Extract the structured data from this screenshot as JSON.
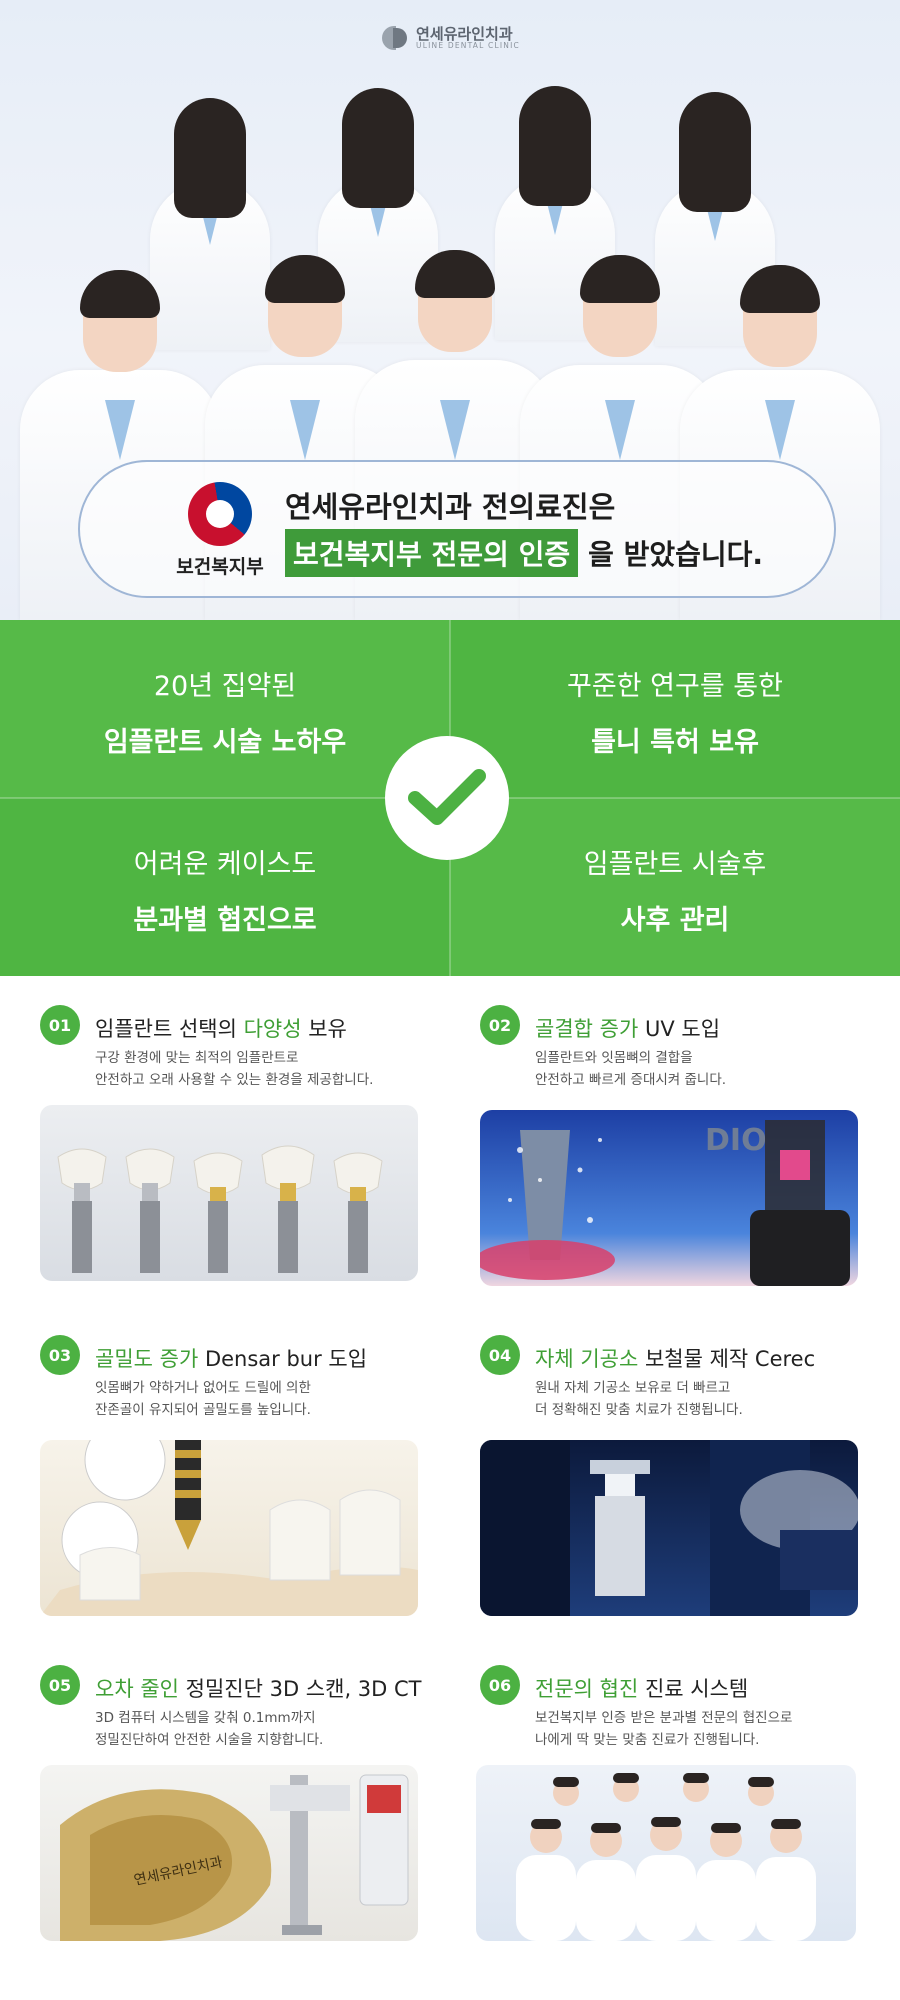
{
  "logo": {
    "name": "연세유라인치과",
    "sub": "ULINE DENTAL CLINIC"
  },
  "cert": {
    "org": "보건복지부",
    "line1": "연세유라인치과 전의료진은",
    "highlight": "보건복지부 전문의 인증",
    "tail": "을 받았습니다."
  },
  "features": [
    {
      "line1": "20년 집약된",
      "line2": "임플란트 시술 노하우"
    },
    {
      "line1": "꾸준한 연구를 통한",
      "line2": "틀니 특허 보유"
    },
    {
      "line1": "어려운 케이스도",
      "line2": "분과별 협진으로"
    },
    {
      "line1": "임플란트 시술후",
      "line2": "사후 관리"
    }
  ],
  "items": [
    {
      "num": "01",
      "pre": "임플란트 선택의 ",
      "hl": "다양성",
      "post": " 보유",
      "desc1": "구강 환경에 맞는 최적의 임플란트로",
      "desc2": "안전하고 오래 사용할 수 있는 환경을 제공합니다."
    },
    {
      "num": "02",
      "pre": "",
      "hl": "골결합 증가",
      "post": " UV 도입",
      "desc1": "임플란트와 잇몸뼈의 결합을",
      "desc2": "안전하고 빠르게 증대시켜 줍니다.",
      "brand": "DIO"
    },
    {
      "num": "03",
      "pre": "",
      "hl": "골밀도 증가",
      "post": " Densar bur 도입",
      "desc1": "잇몸뼈가 약하거나 없어도 드릴에 의한",
      "desc2": "잔존골이 유지되어 골밀도를 높입니다."
    },
    {
      "num": "04",
      "pre": "",
      "hl": "자체 기공소",
      "post": " 보철물 제작 Cerec",
      "desc1": "원내 자체 기공소 보유로 더 빠르고",
      "desc2": "더 정확해진 맞춤 치료가 진행됩니다."
    },
    {
      "num": "05",
      "pre": "",
      "hl": "오차 줄인",
      "post": " 정밀진단 3D 스캔, 3D CT",
      "desc1": "3D 컴퓨터 시스템을 갖춰 0.1mm까지",
      "desc2": "정밀진단하여 안전한 시술을 지향합니다.",
      "stamp": "연세유라인치과"
    },
    {
      "num": "06",
      "pre": "",
      "hl": "전문의 협진",
      "post": " 진료 시스템",
      "desc1": "보건복지부 인증 받은 분과별 전문의 협진으로",
      "desc2": "나에게 딱 맞는 맞춤 진료가 진행됩니다."
    }
  ]
}
